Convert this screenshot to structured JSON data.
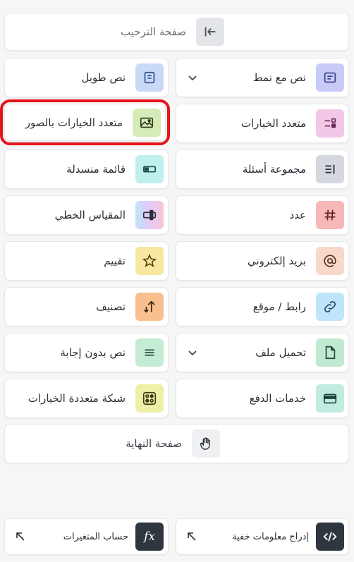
{
  "welcome": {
    "label": "صفحة الترحيب",
    "icon": "collapse-left-icon"
  },
  "items": {
    "styled_text": {
      "label": "نص مع نمط",
      "icon": "text-box-icon",
      "color": "#c9cbf7"
    },
    "long_text": {
      "label": "نص طويل",
      "icon": "document-icon",
      "color": "#c8daf8"
    },
    "multiple_choice": {
      "label": "متعدد الخيارات",
      "icon": "choice-list-icon",
      "color": "#f3c8e6"
    },
    "picture_choice": {
      "label": "متعدد الخيارات بالصور",
      "icon": "image-icon",
      "color": "#d7ebb8"
    },
    "question_group": {
      "label": "مجموعة أسئلة",
      "icon": "group-icon",
      "color": "#d5d8de"
    },
    "dropdown": {
      "label": "قائمة منسدلة",
      "icon": "dropdown-icon",
      "color": "#bff0ee"
    },
    "number": {
      "label": "عدد",
      "icon": "hash-icon",
      "color": "#f7b8b8"
    },
    "linear_scale": {
      "label": "المقياس الخطي",
      "icon": "slider-icon",
      "color": "#d6c8f7"
    },
    "email": {
      "label": "بريد إلكتروني",
      "icon": "at-icon",
      "color": "#f8d8c8"
    },
    "rating": {
      "label": "تقييم",
      "icon": "star-icon",
      "color": "#f8e7a0"
    },
    "url": {
      "label": "رابط / موقع",
      "icon": "link-icon",
      "color": "#bfe4fb"
    },
    "ranking": {
      "label": "تصنيف",
      "icon": "sort-icon",
      "color": "#f8c08e"
    },
    "file_upload": {
      "label": "تحميل ملف",
      "icon": "file-icon",
      "color": "#bfe9d0"
    },
    "statement": {
      "label": "نص بدون إجابة",
      "icon": "lines-icon",
      "color": "#c4ecd4"
    },
    "payment": {
      "label": "خدمات الدفع",
      "icon": "card-icon",
      "color": "#bfebe0"
    },
    "matrix": {
      "label": "شبكة متعددة الخيارات",
      "icon": "grid-icon",
      "color": "#eef0a8"
    }
  },
  "end": {
    "label": "صفحة النهاية",
    "icon": "wave-hand-icon"
  },
  "bottom": {
    "hidden_fields": {
      "label": "إدراج معلومات خفية",
      "icon": "code-icon"
    },
    "variables": {
      "label": "حساب المتغيرات",
      "icon": "function-icon",
      "icon_text": "fx"
    }
  }
}
